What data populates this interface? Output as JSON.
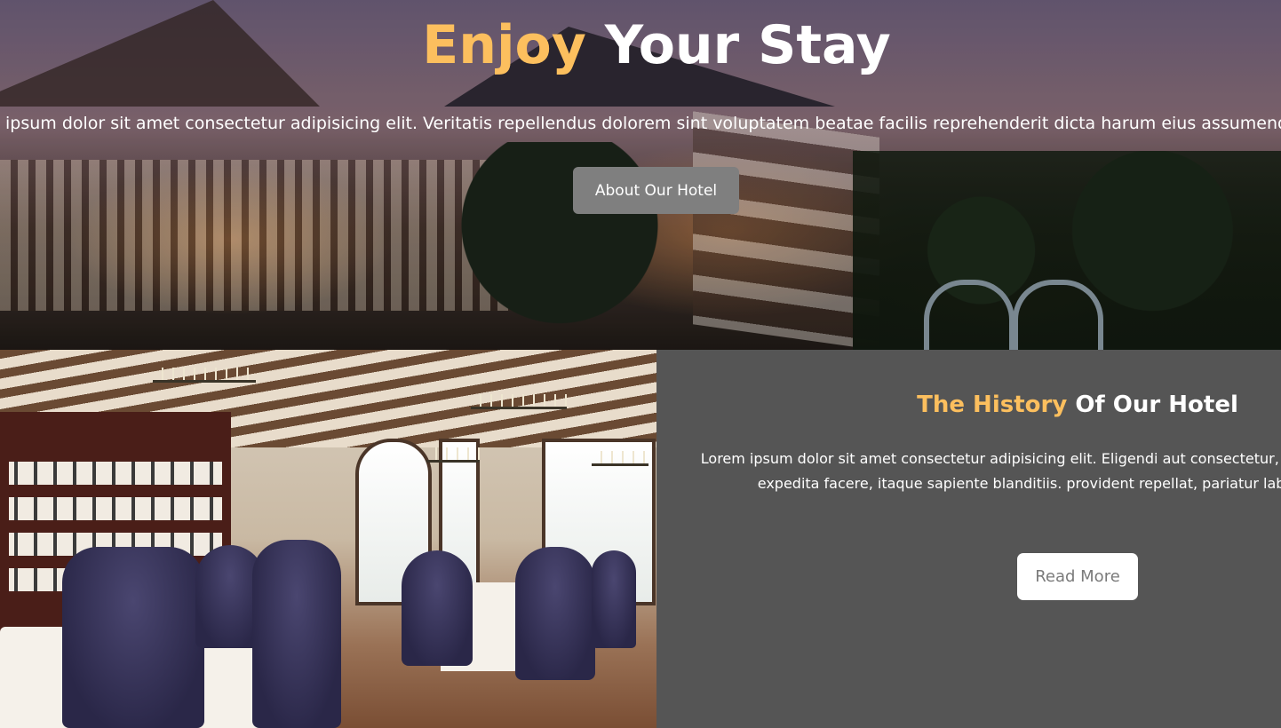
{
  "hero": {
    "title_accent": "Enjoy",
    "title_rest": " Your Stay",
    "text": "ipsum dolor sit amet consectetur adipisicing elit. Veritatis repellendus dolorem sint voluptatem beatae facilis reprehenderit dicta harum eius assumenda",
    "button_label": "About Our Hotel",
    "button_color": "#7f7f7f"
  },
  "history": {
    "title_accent": "The History",
    "title_rest": " Of Our Hotel",
    "text": "Lorem ipsum dolor sit amet consectetur adipisicing elit. Eligendi aut consectetur, doloremque temporibus expedita facere, itaque sapiente blanditiis. provident repellat, pariatur labore nemo iusto!",
    "button_label": "Read More",
    "panel_color": "#555555"
  },
  "colors": {
    "accent": "#fcbf5e",
    "text": "#ffffff"
  }
}
